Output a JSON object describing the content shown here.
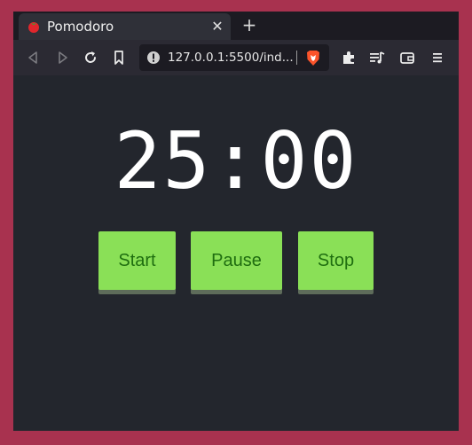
{
  "browser": {
    "tab": {
      "title": "Pomodoro"
    },
    "address": {
      "url": "127.0.0.1:5500/ind..."
    }
  },
  "timer": {
    "display": "25:00"
  },
  "controls": {
    "start_label": "Start",
    "pause_label": "Pause",
    "stop_label": "Stop"
  },
  "colors": {
    "page_background": "#23262d",
    "button_green": "#8ae057",
    "button_text": "#1f6e10",
    "frame": "#a8324f"
  },
  "icons": [
    "tomato-favicon-icon",
    "close-icon",
    "plus-icon",
    "back-icon",
    "forward-icon",
    "reload-icon",
    "bookmark-icon",
    "info-icon",
    "brave-shield-icon",
    "extensions-icon",
    "playlist-icon",
    "wallet-icon",
    "menu-icon"
  ]
}
